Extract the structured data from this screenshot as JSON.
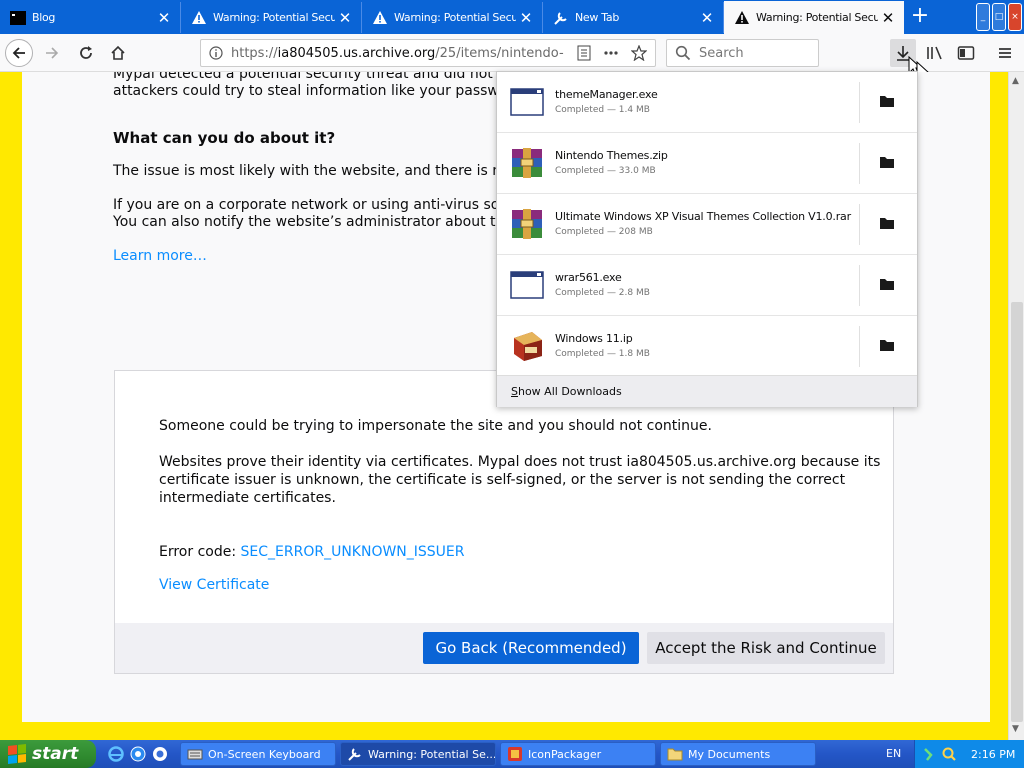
{
  "tabs": [
    {
      "title": "Blog",
      "active": false
    },
    {
      "title": "Warning: Potential Security Risk Ahead",
      "active": false
    },
    {
      "title": "Warning: Potential Security Risk Ahead",
      "active": false
    },
    {
      "title": "New Tab",
      "active": false
    },
    {
      "title": "Warning: Potential Security Risk Ahead",
      "active": true
    }
  ],
  "new_tab_label": "+",
  "window_buttons": {
    "minimize": "_",
    "maximize": "□",
    "close": "×"
  },
  "navbar": {
    "url_prefix": "https://",
    "url_domain": "ia804505.us.archive.org",
    "url_path": "/25/items/nintendo-",
    "search_placeholder": "Search"
  },
  "page": {
    "para_line1": "Mypal detected a potential security threat and did not continue",
    "para_line2": "attackers could try to steal information like your passwords,",
    "heading": "What can you do about it?",
    "issue_line": "The issue is most likely with the website, and there is nothin",
    "corp_line1": "If you are on a corporate network or using anti-virus softwa",
    "corp_line2": "You can also notify the website’s administrator about the p",
    "learn_more": "Learn more…",
    "adv_line1": "Someone could be trying to impersonate the site and you should not continue.",
    "adv_line2": "Websites prove their identity via certificates. Mypal does not trust ia804505.us.archive.org because its",
    "adv_line3": "certificate issuer is unknown, the certificate is self-signed, or the server is not sending the correct",
    "adv_line4": "intermediate certificates.",
    "error_label": "Error code: ",
    "error_code": "SEC_ERROR_UNKNOWN_ISSUER",
    "view_cert": "View Certificate",
    "go_back": "Go Back (Recommended)",
    "accept": "Accept the Risk and Continue"
  },
  "downloads": {
    "items": [
      {
        "name": "themeManager.exe",
        "status": "Completed — 1.4 MB",
        "icon": "exe-window-icon"
      },
      {
        "name": "Nintendo Themes.zip",
        "status": "Completed — 33.0 MB",
        "icon": "winrar-archive-icon"
      },
      {
        "name": "Ultimate Windows XP Visual Themes Collection V1.0.rar",
        "status": "Completed — 208 MB",
        "icon": "winrar-archive-icon"
      },
      {
        "name": "wrar561.exe",
        "status": "Completed — 2.8 MB",
        "icon": "exe-window-icon"
      },
      {
        "name": "Windows 11.ip",
        "status": "Completed — 1.8 MB",
        "icon": "ip-patch-icon"
      }
    ],
    "show_all_prefix": "S",
    "show_all_rest": "how All Downloads"
  },
  "taskbar": {
    "start": "start",
    "buttons": [
      {
        "label": "On-Screen Keyboard",
        "active": false
      },
      {
        "label": "Warning: Potential Se...",
        "active": true
      },
      {
        "label": "IconPackager",
        "active": false
      },
      {
        "label": "My Documents",
        "active": false
      }
    ],
    "lang": "EN",
    "clock": "2:16 PM"
  },
  "colors": {
    "accent": "#0a64d6",
    "link": "#0a8dff",
    "warning_border": "#ffe900"
  }
}
